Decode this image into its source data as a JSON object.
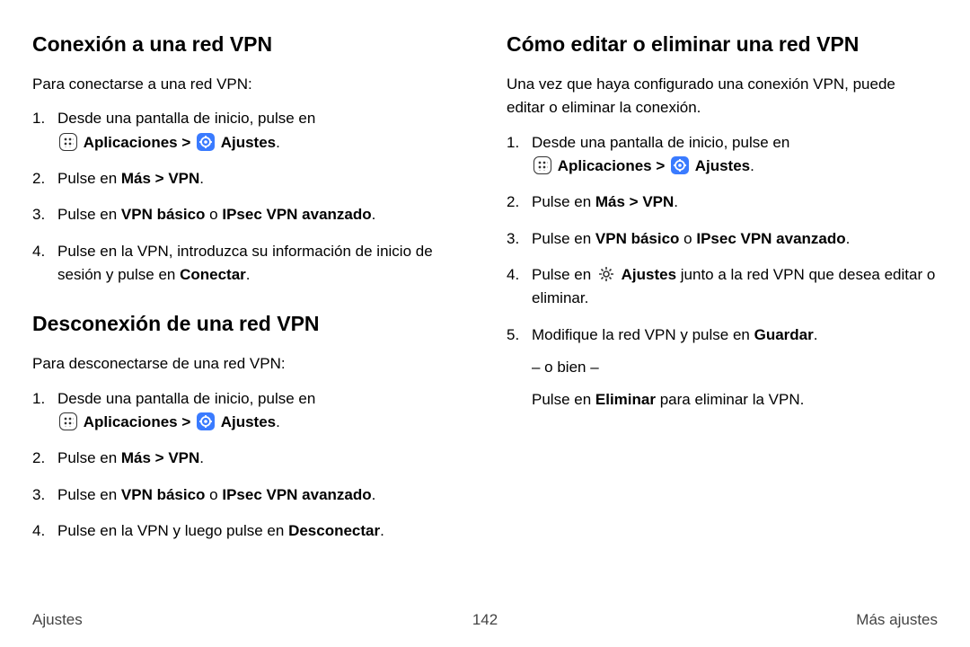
{
  "left": {
    "section1": {
      "heading": "Conexión a una red VPN",
      "intro": "Para conectarse a una red VPN:",
      "steps": {
        "s1": "Desde una pantalla de inicio, pulse en ",
        "s1_apps": "Aplicaciones",
        "s1_sep": " > ",
        "s1_settings": "Ajustes",
        "s1_end": ".",
        "s2a": "Pulse en ",
        "s2b": "Más > VPN",
        "s2c": ".",
        "s3a": "Pulse en ",
        "s3b": "VPN básico",
        "s3c": " o ",
        "s3d": "IPsec VPN avanzado",
        "s3e": ".",
        "s4a": "Pulse en la VPN, introduzca su información de inicio de sesión y pulse en ",
        "s4b": "Conectar",
        "s4c": "."
      }
    },
    "section2": {
      "heading": "Desconexión de una red VPN",
      "intro": "Para desconectarse de una red VPN:",
      "steps": {
        "s1": "Desde una pantalla de inicio, pulse en ",
        "s1_apps": "Aplicaciones",
        "s1_sep": " > ",
        "s1_settings": "Ajustes",
        "s1_end": ".",
        "s2a": "Pulse en ",
        "s2b": "Más > VPN",
        "s2c": ".",
        "s3a": "Pulse en ",
        "s3b": "VPN básico",
        "s3c": " o ",
        "s3d": "IPsec VPN avanzado",
        "s3e": ".",
        "s4a": "Pulse en la VPN y luego pulse en ",
        "s4b": "Desconectar",
        "s4c": "."
      }
    }
  },
  "right": {
    "section": {
      "heading": "Cómo editar o eliminar una red VPN",
      "intro": "Una vez que haya configurado una conexión VPN, puede editar o eliminar la conexión.",
      "steps": {
        "s1": "Desde una pantalla de inicio, pulse en ",
        "s1_apps": "Aplicaciones",
        "s1_sep": " > ",
        "s1_settings": "Ajustes",
        "s1_end": ".",
        "s2a": "Pulse en ",
        "s2b": "Más > VPN",
        "s2c": ".",
        "s3a": "Pulse en ",
        "s3b": "VPN básico",
        "s3c": " o ",
        "s3d": "IPsec VPN avanzado",
        "s3e": ".",
        "s4a": "Pulse en ",
        "s4b": "Ajustes",
        "s4c": " junto a la red VPN que desea editar o eliminar.",
        "s5a": "Modifique la red VPN y pulse en ",
        "s5b": "Guardar",
        "s5c": ".",
        "s5_or": "– o bien –",
        "s5d": "Pulse en ",
        "s5e": "Eliminar",
        "s5f": " para eliminar la VPN."
      }
    }
  },
  "footer": {
    "left": "Ajustes",
    "center": "142",
    "right": "Más ajustes"
  }
}
